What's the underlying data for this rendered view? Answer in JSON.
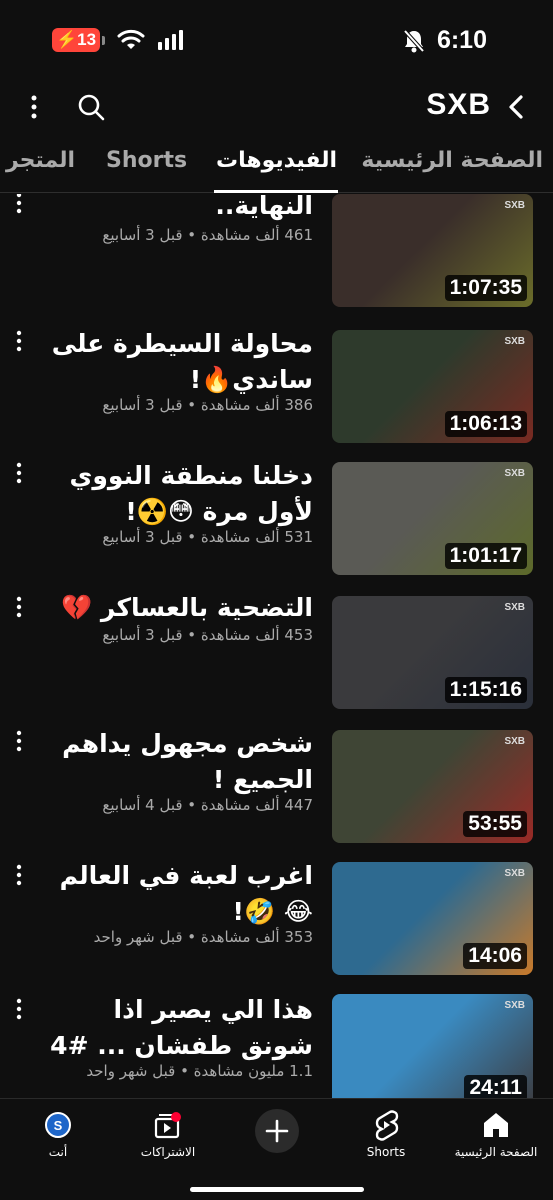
{
  "status_bar": {
    "battery": "13",
    "time": "6:10"
  },
  "header": {
    "channel_name": "SXB"
  },
  "tabs": [
    {
      "label": "الصفحة الرئيسية",
      "active": false
    },
    {
      "label": "الفيديوهات",
      "active": true
    },
    {
      "label": "Shorts",
      "active": false
    },
    {
      "label": "المتجر",
      "active": false
    }
  ],
  "videos": [
    {
      "title": "النهاية..",
      "meta": "461 ألف مشاهدة • قبل 3 أسابيع",
      "duration": "1:07:35",
      "thumb_colors": [
        "#3a2e2a",
        "#6b6d2a"
      ]
    },
    {
      "title": "محاولة السيطرة على ساندي🔥!",
      "meta": "386 ألف مشاهدة • قبل 3 أسابيع",
      "duration": "1:06:13",
      "thumb_colors": [
        "#2e3a2c",
        "#7a2a22"
      ]
    },
    {
      "title": "دخلنا منطقة النووي لأول مرة 😳☢️!",
      "meta": "531 ألف مشاهدة • قبل 3 أسابيع",
      "duration": "1:01:17",
      "thumb_colors": [
        "#5a5a55",
        "#5d6a2a"
      ]
    },
    {
      "title": "التضحية بالعساكر 💔",
      "meta": "453 ألف مشاهدة • قبل 3 أسابيع",
      "duration": "1:15:16",
      "thumb_colors": [
        "#3a3a3d",
        "#2a2f3a"
      ]
    },
    {
      "title": "شخص مجهول يداهم الجميع !",
      "meta": "447 ألف مشاهدة • قبل 4 أسابيع",
      "duration": "53:55",
      "thumb_colors": [
        "#3f4535",
        "#9a2a26"
      ]
    },
    {
      "title": "اغرب لعبة في العالم😂 🤣!",
      "meta": "353 ألف مشاهدة • قبل شهر واحد",
      "duration": "14:06",
      "thumb_colors": [
        "#2e6a90",
        "#c97a2a"
      ]
    },
    {
      "title": "هذا الي يصير اذا شونق طفشان ... #4",
      "meta": "1.1 مليون مشاهدة • قبل شهر واحد",
      "duration": "24:11",
      "thumb_colors": [
        "#3a8ac0",
        "#3c3c40"
      ]
    }
  ],
  "bottom_nav": {
    "home": "الصفحة الرئيسية",
    "shorts": "Shorts",
    "subscriptions": "الاشتراكات",
    "you": "أنت",
    "avatar_letter": "S"
  },
  "colors": {
    "background": "#0f0f0f",
    "notification_dot": "#ff0033",
    "battery_alert": "#ff453a",
    "avatar": "#1e66c9"
  },
  "icons": [
    "back-chevron-icon",
    "search-icon",
    "more-vert-icon",
    "wifi-icon",
    "signal-icon",
    "silent-bell-icon",
    "home-icon",
    "shorts-icon",
    "plus-icon",
    "subscriptions-icon"
  ]
}
